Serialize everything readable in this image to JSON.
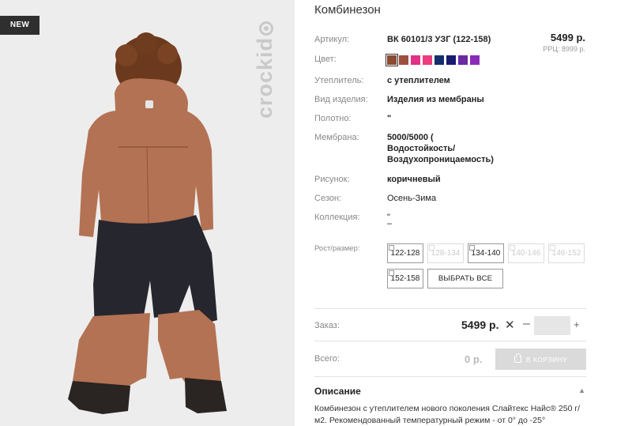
{
  "badge": {
    "label": "NEW"
  },
  "brand": {
    "watermark": "crockid"
  },
  "product": {
    "title": "Комбинезон",
    "price": "5499 р.",
    "rrp": "РРЦ: 8999 р."
  },
  "attributes": {
    "article": {
      "label": "Артикул:",
      "value": "ВК 60101/3 УЗГ (122-158)"
    },
    "color": {
      "label": "Цвет:"
    },
    "insulation": {
      "label": "Утеплитель:",
      "value": "с утеплителем"
    },
    "kind": {
      "label": "Вид изделия:",
      "value": "Изделия из мембраны"
    },
    "fabric": {
      "label": "Полотно:",
      "value": "\""
    },
    "membrane": {
      "label": "Мембрана:",
      "line1": "5000/5000 (",
      "line2": "Водостойкость/",
      "line3": "Воздухопроницаемость)"
    },
    "pattern": {
      "label": "Рисунок:",
      "value": "коричневый"
    },
    "season": {
      "label": "Сезон:",
      "value": "Осень-Зима"
    },
    "collection": {
      "label": "Коллекция:",
      "line1": "\"",
      "line2": "–"
    }
  },
  "swatches": [
    {
      "color": "#8b4a32",
      "selected": true
    },
    {
      "color": "#9b5040",
      "selected": false
    },
    {
      "color": "#e03088",
      "selected": false
    },
    {
      "color": "#ee3c7e",
      "selected": false
    },
    {
      "color": "#142e6e",
      "selected": false
    },
    {
      "color": "#1a1a6e",
      "selected": false
    },
    {
      "color": "#6a2aa0",
      "selected": false
    },
    {
      "color": "#8b2ab8",
      "selected": false
    }
  ],
  "sizes": {
    "label": "Рост/размер:",
    "options": [
      {
        "label": "122-128",
        "enabled": true
      },
      {
        "label": "128-134",
        "enabled": false
      },
      {
        "label": "134-140",
        "enabled": true
      },
      {
        "label": "140-146",
        "enabled": false
      },
      {
        "label": "146-152",
        "enabled": false
      },
      {
        "label": "152-158",
        "enabled": true
      }
    ],
    "select_all": "ВЫБРАТЬ ВСЕ"
  },
  "order": {
    "label": "Заказ:",
    "price": "5499 р.",
    "remove": "✕",
    "minus": "–",
    "plus": "+",
    "qty": ""
  },
  "total": {
    "label": "Всего:",
    "value": "0 р.",
    "cart_button": "В КОРЗИНУ"
  },
  "description": {
    "title": "Описание",
    "text": "Комбинезон с утеплителем нового поколения Слайтекс Найс® 250 г/м2. Рекомендованный температурный режим - от 0° до -25°"
  },
  "icons": {
    "caret": "caret-up-icon",
    "cart": "cart-icon"
  }
}
